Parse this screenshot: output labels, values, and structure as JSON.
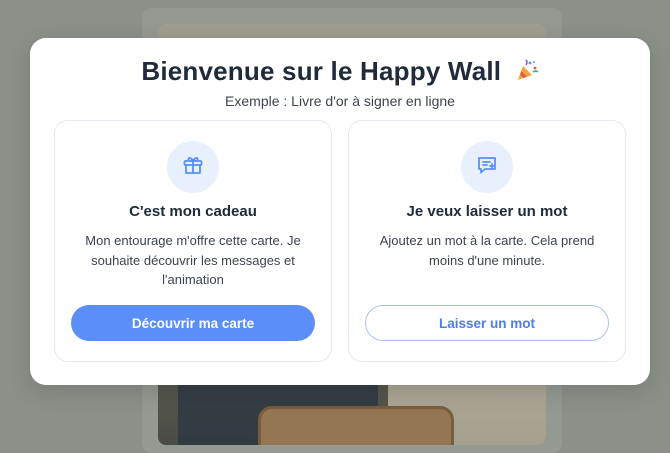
{
  "modal": {
    "title": "Bienvenue sur le Happy Wall",
    "title_emoji_icon": "party-popper-icon",
    "subtitle": "Exemple : Livre d'or à signer en ligne"
  },
  "cards": [
    {
      "icon": "gift-icon",
      "title": "C'est mon cadeau",
      "text": "Mon entourage m'offre cette carte. Je souhaite découvrir les messages et l'animation",
      "button_label": "Découvrir ma carte"
    },
    {
      "icon": "message-plus-icon",
      "title": "Je veux laisser un mot",
      "text": "Ajoutez un mot à la carte. Cela prend moins d'une minute.",
      "button_label": "Laisser un mot"
    }
  ],
  "colors": {
    "accent": "#5c8ef8",
    "icon_bg": "#e9f0fd",
    "title": "#1f2a3a"
  }
}
